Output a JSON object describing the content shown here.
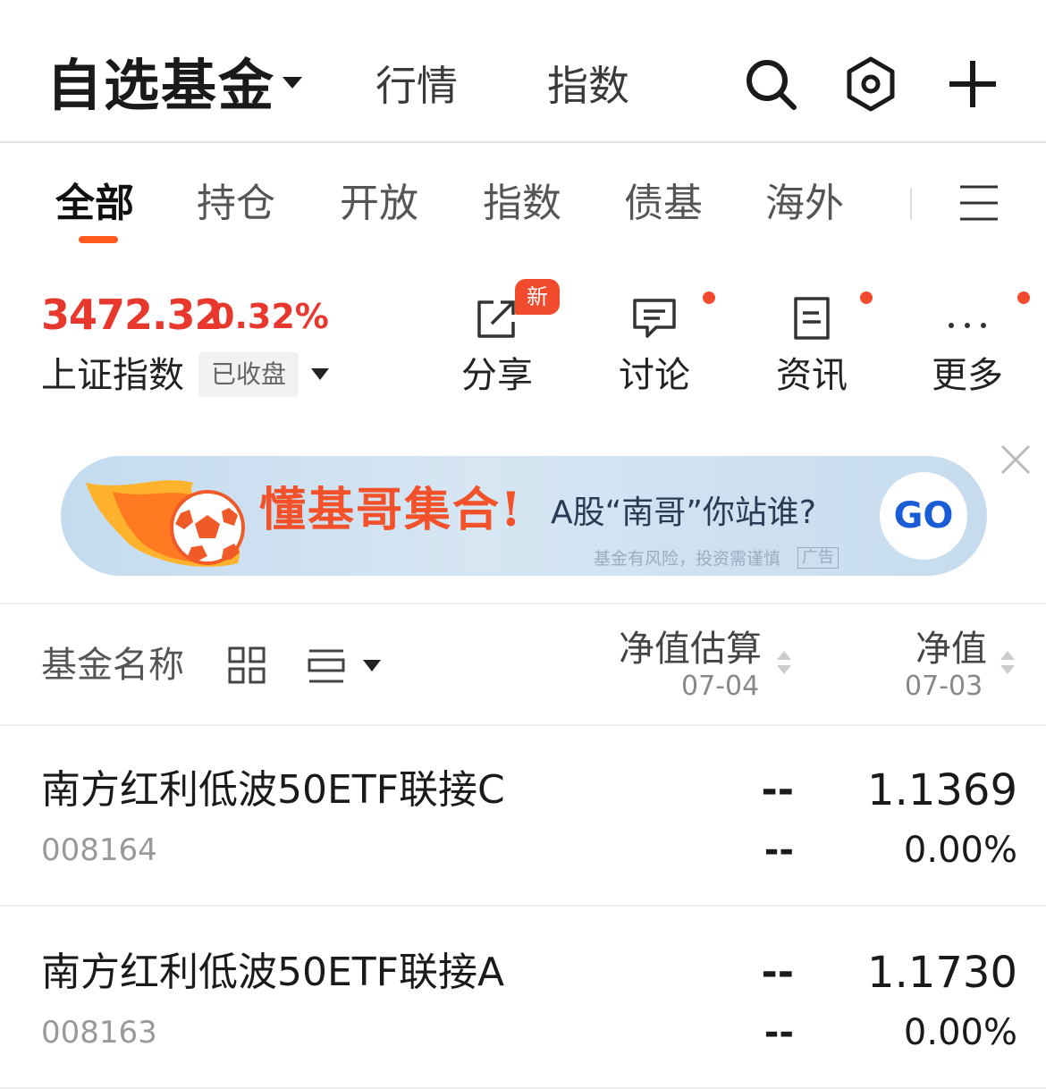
{
  "header": {
    "title": "自选基金",
    "tabs": [
      "行情",
      "指数"
    ],
    "icons": [
      "search-icon",
      "settings-hexagon-icon",
      "plus-icon"
    ]
  },
  "categories": {
    "items": [
      "全部",
      "持仓",
      "开放",
      "指数",
      "债基",
      "海外"
    ],
    "active_index": 0,
    "accent_color": "#ff5a1f"
  },
  "index": {
    "value": "3472.32",
    "change": "0.32%",
    "name": "上证指数",
    "status": "已收盘",
    "color": "#e8382e"
  },
  "actions": {
    "share": "分享",
    "discuss": "讨论",
    "news": "资讯",
    "more": "更多",
    "new_badge": "新"
  },
  "banner": {
    "title": "懂基哥集合!",
    "tagline": "A股“南哥”你站谁?",
    "go": "GO",
    "disclaimer": "基金有风险，投资需谨慎",
    "ad_tag": "广告"
  },
  "list_header": {
    "name": "基金名称",
    "estimate": "净值估算",
    "estimate_date": "07-04",
    "nav": "净值",
    "nav_date": "07-03"
  },
  "funds": [
    {
      "name": "南方红利低波50ETF联接C",
      "code": "008164",
      "estimate": "--",
      "estimate_change": "--",
      "nav": "1.1369",
      "nav_change": "0.00%"
    },
    {
      "name": "南方红利低波50ETF联接A",
      "code": "008163",
      "estimate": "--",
      "estimate_change": "--",
      "nav": "1.1730",
      "nav_change": "0.00%"
    }
  ]
}
